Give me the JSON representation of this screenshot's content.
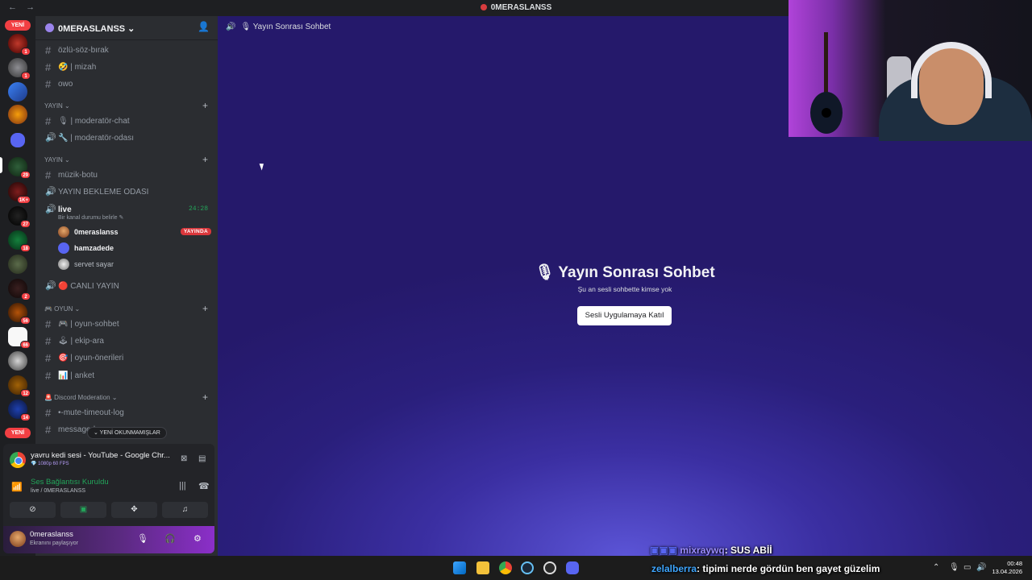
{
  "titlebar": {
    "title": "0MERASLANSS",
    "back": "←",
    "forward": "→"
  },
  "servers": {
    "new_top": "YENİ",
    "new_bottom": "YENİ",
    "badges": [
      "1",
      "1",
      "29",
      "1K+",
      "27",
      "18",
      "2",
      "56",
      "66",
      "12",
      "14"
    ]
  },
  "guild": {
    "name": "0MERASLANSS ⌄",
    "invite_icon": "add-member-icon"
  },
  "channels": {
    "c1": "özlü-söz-bırak",
    "c2": "🤣 | mizah",
    "c3": "owo",
    "cat1": "YAYIN ⌄",
    "c4": "🎙 | moderatör-chat",
    "c5": "🔧 | moderatör-odası",
    "cat2": "YAYIN ⌄",
    "c6": "müzik-botu",
    "c7": "YAYIN BEKLEME ODASI",
    "c8": "live",
    "c8_timer": "24:28",
    "c8_sub": "Bir kanal durumu belirle ✎",
    "c9": "🔴 CANLI YAYIN",
    "cat3": "🎮 OYUN ⌄",
    "c10": "🎮 | oyun-sohbet",
    "c11": "🕹 | ekip-ara",
    "c12": "🎯 | oyun-önerileri",
    "c13": "📊 | anket",
    "cat4": "🚨 Discord Moderation ⌄",
    "c14": "•-mute-timeout-log",
    "c15": "message-l"
  },
  "voice_users": [
    {
      "name": "0meraslanss",
      "tag": "YAYINDA"
    },
    {
      "name": "hamzadede",
      "tag": ""
    },
    {
      "name": "servet sayar",
      "tag": ""
    }
  ],
  "unread": "⌄ YENİ OKUNMAMIŞLAR",
  "panel": {
    "share_title": "yavru kedi sesi - YouTube - Google Chr...",
    "share_sub": "💎 1080p 60 FPS",
    "voice_title": "Ses Bağlantısı Kuruldu",
    "voice_sub": "live / 0MERASLANSS",
    "user_name": "0meraslanss",
    "user_status": "Ekranını paylaşıyor"
  },
  "main": {
    "header": "🎙 Yayın Sonrası Sohbet",
    "title": "🎙 Yayın Sonrası Sohbet",
    "subtitle": "Şu an sesli sohbette kimse yok",
    "join": "Sesli Uygulamaya Katıl"
  },
  "overlay": {
    "line1_user": "mixraywq",
    "line1_msg": ": SUS ABİİ",
    "line2_user": "zelalberra",
    "line2_msg": ": tipimi nerde gördün ben gayet güzelim"
  },
  "clock": {
    "time": "00:48",
    "date": "13.04.2026"
  },
  "colors": {
    "accent": "#5865f2",
    "online": "#23a55a",
    "danger": "#da373c"
  }
}
